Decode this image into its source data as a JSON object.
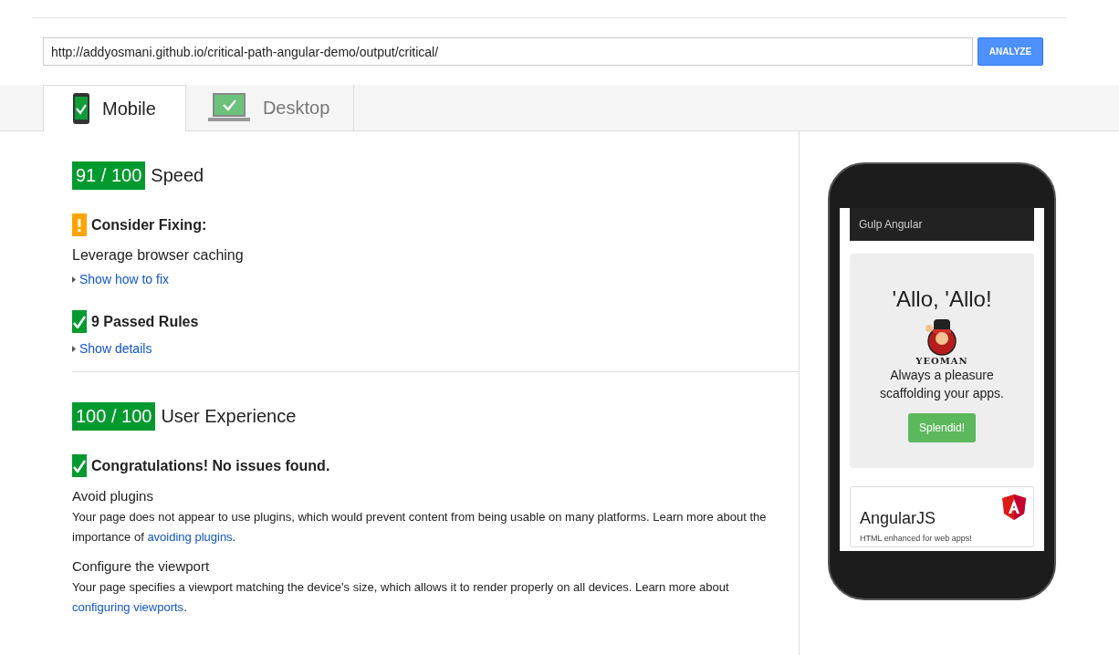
{
  "url_field": {
    "value": "http://addyosmani.github.io/critical-path-angular-demo/output/critical/"
  },
  "analyze_button": "ANALYZE",
  "tabs": [
    {
      "label": "Mobile",
      "selected": true,
      "kind": "phone"
    },
    {
      "label": "Desktop",
      "selected": false,
      "kind": "laptop"
    }
  ],
  "sections": [
    {
      "score": "91 / 100",
      "title": "Speed",
      "groups": [
        {
          "kind": "warning",
          "heading": "Consider Fixing:",
          "items": [
            {
              "title": "Leverage browser caching"
            }
          ],
          "toggle": "Show how to fix"
        },
        {
          "kind": "passed",
          "heading": "9 Passed Rules",
          "toggle": "Show details"
        }
      ]
    },
    {
      "score": "100 / 100",
      "title": "User Experience",
      "groups": [
        {
          "kind": "passed",
          "heading": "Congratulations! No issues found.",
          "items": [
            {
              "title": "Avoid plugins",
              "text_before": "Your page does not appear to use plugins, which would prevent content from being usable on many platforms. Learn more about the importance of ",
              "link": "avoiding plugins",
              "text_after": "."
            },
            {
              "title": "Configure the viewport",
              "text_before": "Your page specifies a viewport matching the device's size, which allows it to render properly on all devices. Learn more about ",
              "link": "configuring viewports",
              "text_after": "."
            }
          ]
        }
      ]
    }
  ],
  "preview": {
    "navbar_title": "Gulp Angular",
    "heading": "'Allo, 'Allo!",
    "logo_text": "YEOMAN",
    "tagline": "Always a pleasure scaffolding your apps.",
    "button": "Splendid!",
    "card_title": "AngularJS",
    "card_text": "HTML enhanced for web apps!"
  }
}
